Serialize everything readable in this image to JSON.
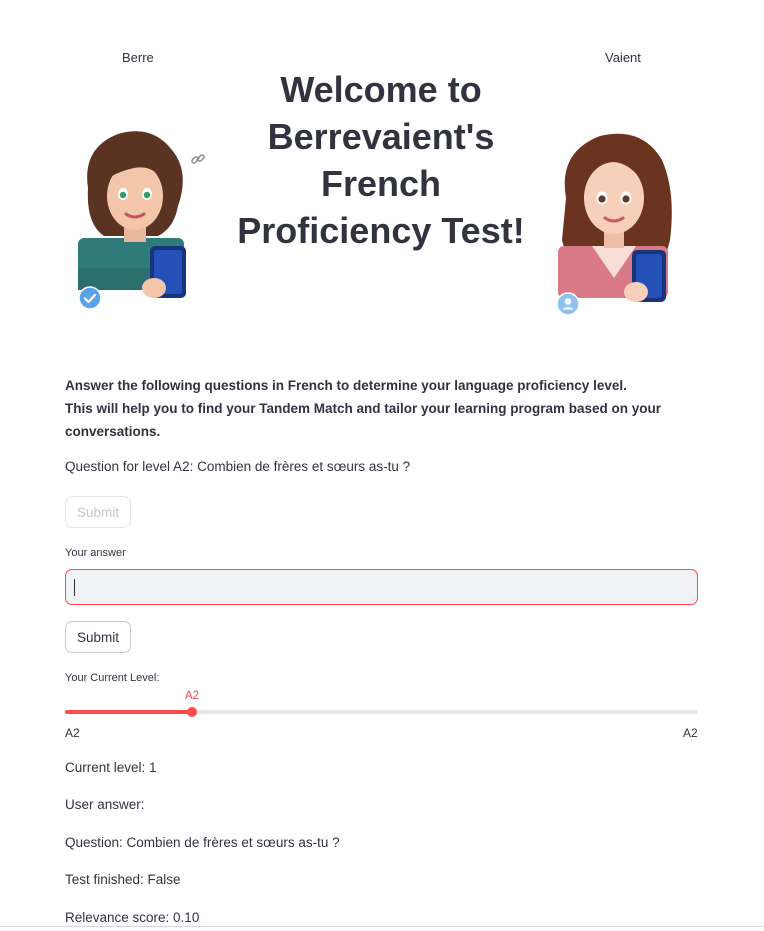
{
  "header": {
    "left_name": "Berre",
    "right_name": "Vaient",
    "title": "Welcome to Berrevaient's French Proficiency Test!"
  },
  "intro": {
    "line1": "Answer the following questions in French to determine your language proficiency level.",
    "line2": "This will help you to find your Tandem Match and tailor your learning program based on your conversations."
  },
  "question_prompt": "Question for level A2: Combien de frères et sœurs as-tu ?",
  "form": {
    "submit_disabled_label": "Submit",
    "answer_label": "Your answer",
    "answer_value": "",
    "submit_label": "Submit"
  },
  "level_slider": {
    "label": "Your Current Level:",
    "value_label": "A2",
    "fill_fraction": 0.2,
    "min_label": "A2",
    "max_label": "A2"
  },
  "status": {
    "current_level": "Current level: 1",
    "user_answer": "User answer:",
    "question": "Question: Combien de frères et sœurs as-tu ?",
    "test_finished": "Test finished: False",
    "relevance": "Relevance score: 0.10"
  },
  "icons": {
    "link": "link-icon",
    "verified": "check-badge-icon",
    "user": "user-badge-icon"
  },
  "colors": {
    "accent": "#ff4b4b",
    "text": "#31333f",
    "input_bg": "#f0f2f6"
  }
}
